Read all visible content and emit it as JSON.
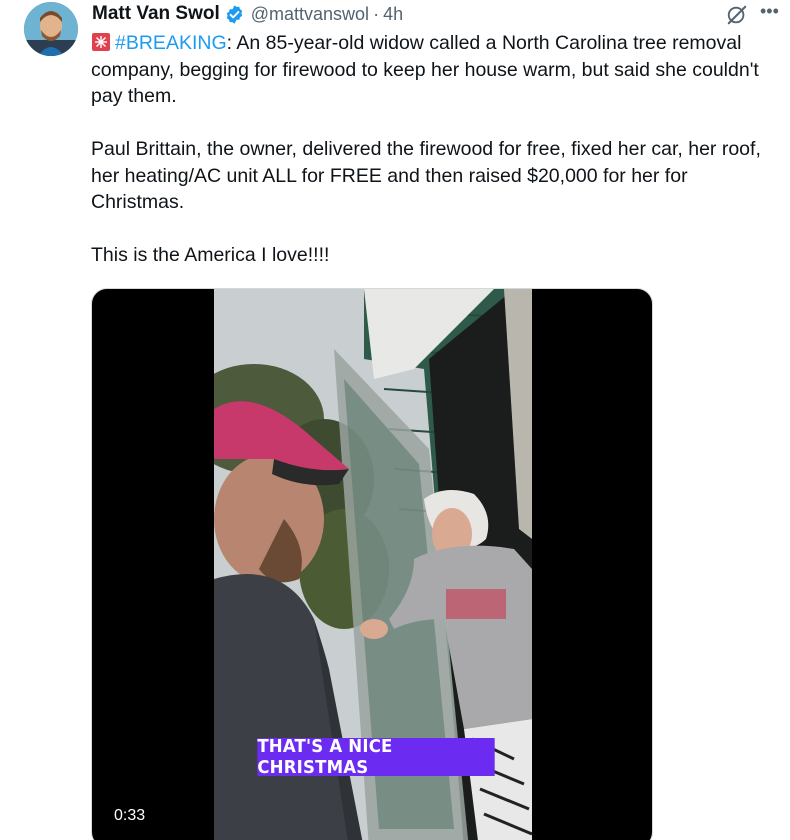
{
  "author": {
    "name": "Matt Van Swol",
    "handle": "@mattvanswol",
    "separator": "·",
    "time": "4h",
    "verified": true
  },
  "tweet": {
    "hashtag": "#BREAKING",
    "line1_rest": ": An 85-year-old widow called a North Carolina tree removal company, begging for firewood to keep her house warm, but said she couldn't pay them.",
    "paragraph2": "Paul Brittain, the owner, delivered the firewood for free, fixed her car, her roof, her heating/AC unit ALL for FREE and then raised $20,000 for her for Christmas.",
    "paragraph3": "This is the America I love!!!!"
  },
  "media": {
    "caption": "THAT'S A NICE CHRISTMAS",
    "duration": "0:33"
  },
  "colors": {
    "link": "#1d9bf0",
    "verified": "#1d9bf0",
    "caption_bg": "#6b2bf0",
    "text": "#0f1419",
    "secondary": "#536471"
  },
  "icons": [
    "avatar",
    "verified-badge-icon",
    "grok-icon",
    "more-options-icon",
    "siren-emoji-icon"
  ]
}
